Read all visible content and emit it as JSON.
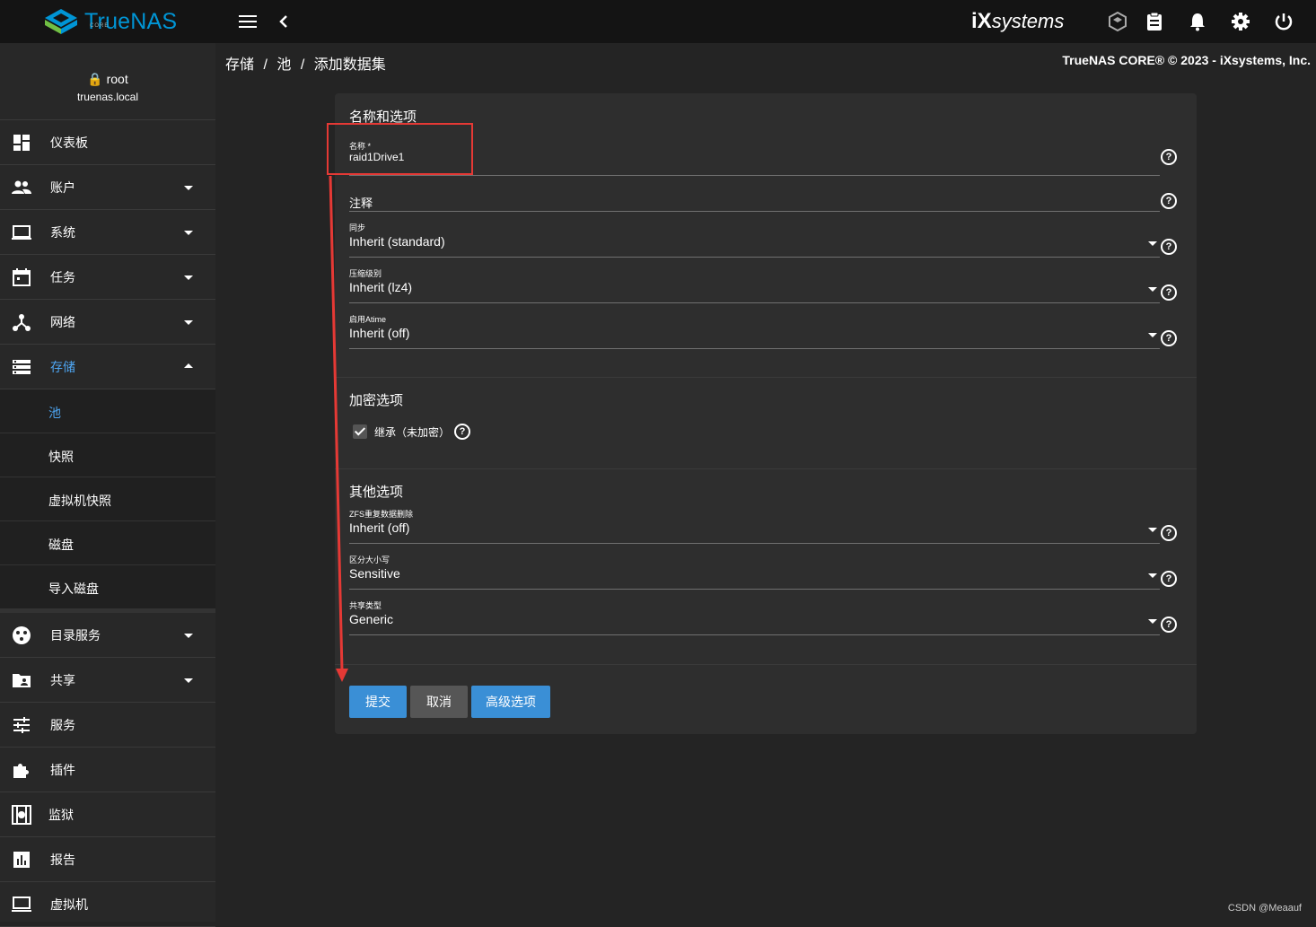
{
  "topbar": {
    "logo_text": "TrueNAS",
    "logo_sub": "CORE",
    "vendor": "systems",
    "vendor_prefix": "iX"
  },
  "user": {
    "name": "root",
    "host": "truenas.local"
  },
  "sidebar": {
    "items": [
      {
        "label": "仪表板"
      },
      {
        "label": "账户"
      },
      {
        "label": "系统"
      },
      {
        "label": "任务"
      },
      {
        "label": "网络"
      },
      {
        "label": "存储"
      }
    ],
    "storage_sub": [
      {
        "label": "池"
      },
      {
        "label": "快照"
      },
      {
        "label": "虚拟机快照"
      },
      {
        "label": "磁盘"
      },
      {
        "label": "导入磁盘"
      }
    ],
    "items2": [
      {
        "label": "目录服务"
      },
      {
        "label": "共享"
      },
      {
        "label": "服务"
      },
      {
        "label": "插件"
      },
      {
        "label": "监狱"
      },
      {
        "label": "报告"
      },
      {
        "label": "虚拟机"
      }
    ]
  },
  "breadcrumb": [
    "存储",
    "/",
    "池",
    "/",
    "添加数据集"
  ],
  "copyright": "TrueNAS CORE® © 2023 - iXsystems, Inc.",
  "form": {
    "section1": "名称和选项",
    "name_label": "名称 *",
    "name_value": "raid1Drive1",
    "comment_placeholder": "注释",
    "sync_label": "同步",
    "sync_value": "Inherit (standard)",
    "compression_label": "压缩级别",
    "compression_value": "Inherit (lz4)",
    "atime_label": "启用Atime",
    "atime_value": "Inherit (off)",
    "section2": "加密选项",
    "inherit_label": "继承（未加密）",
    "section3": "其他选项",
    "dedup_label": "ZFS重复数据删除",
    "dedup_value": "Inherit (off)",
    "case_label": "区分大小写",
    "case_value": "Sensitive",
    "share_label": "共享类型",
    "share_value": "Generic",
    "help_glyph": "?",
    "buttons": {
      "submit": "提交",
      "cancel": "取消",
      "advanced": "高级选项"
    }
  },
  "watermark": "CSDN @Meaauf",
  "colors": {
    "accent": "#3a8fd6",
    "annotation": "#e53935",
    "brand_green": "#71BF44",
    "brand_blue": "#0095D5"
  }
}
